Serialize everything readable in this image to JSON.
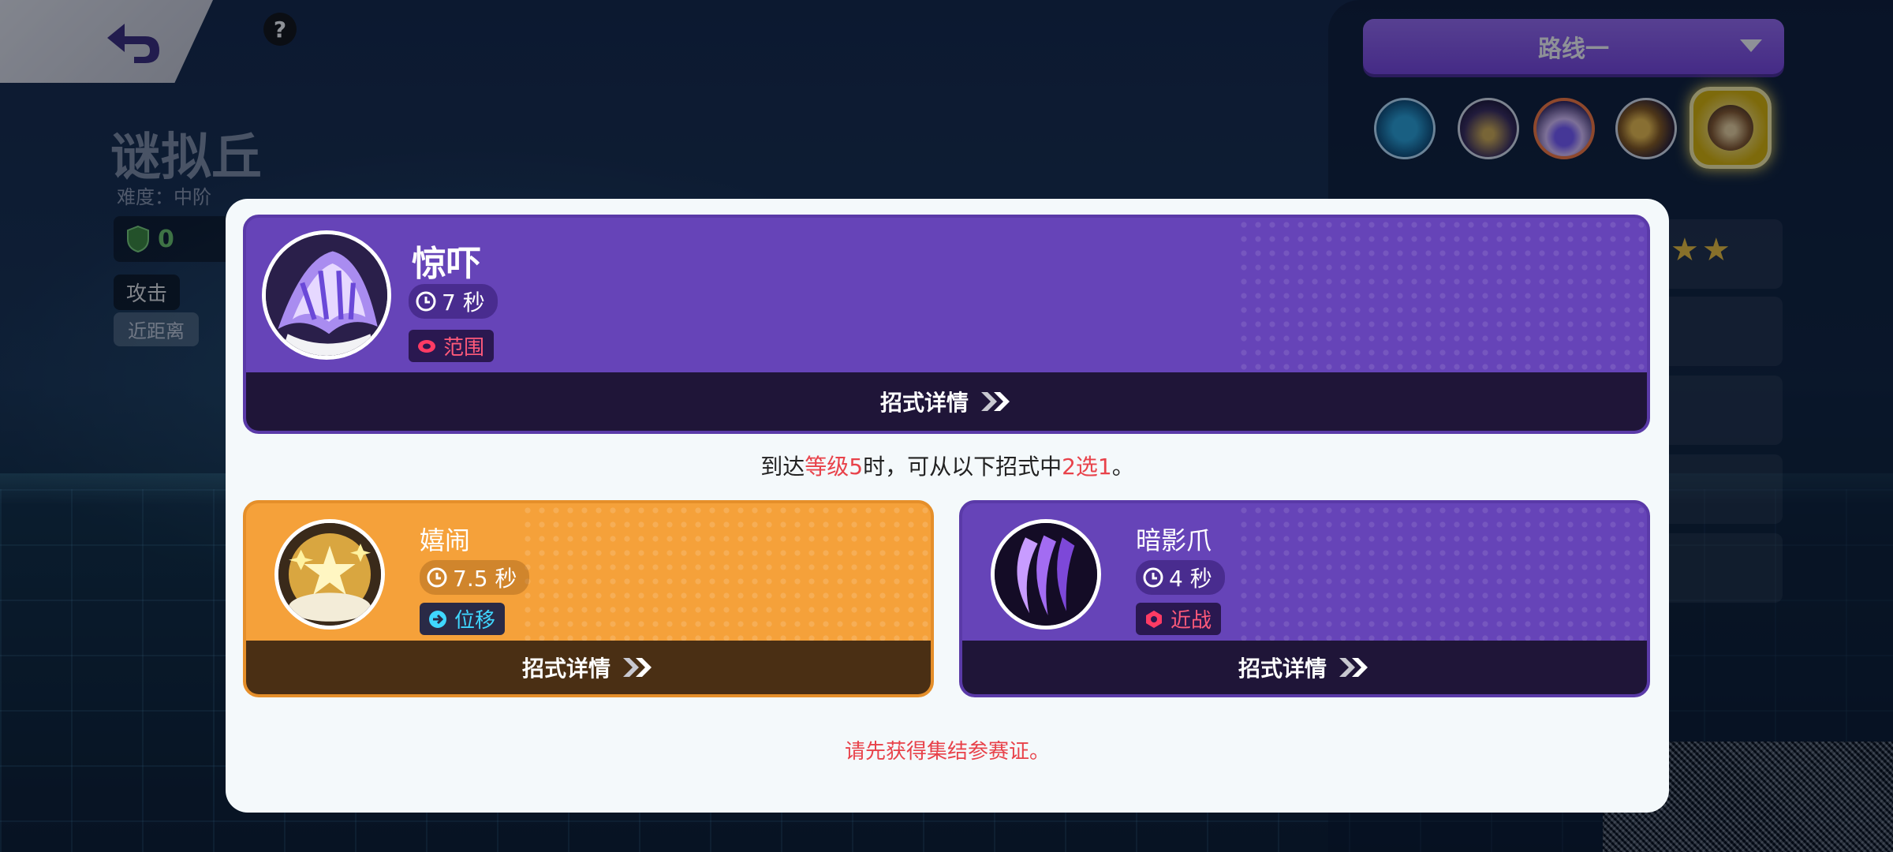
{
  "map": {
    "name": "谜拟丘",
    "difficulty": "难度：中阶",
    "score": "0",
    "role_tag": "攻击",
    "range_tag": "近距离"
  },
  "route": {
    "selected": "路线一"
  },
  "main_move": {
    "name": "惊吓",
    "cooldown": "7 秒",
    "type": "范围",
    "details_label": "招式详情"
  },
  "level_info": {
    "prefix": "到达",
    "level": "等级5",
    "middle": "时，可从以下招式中",
    "choice": "2选1",
    "suffix": "。"
  },
  "option_moves": [
    {
      "name": "嬉闹",
      "cooldown": "7.5 秒",
      "type": "位移",
      "details_label": "招式详情",
      "color": "#f5a13a"
    },
    {
      "name": "暗影爪",
      "cooldown": "4 秒",
      "type": "近战",
      "details_label": "招式详情",
      "color": "#6644b8"
    }
  ],
  "warning": "请先获得集结参赛证。",
  "colors": {
    "accent_purple": "#6644b8",
    "accent_orange": "#f5a13a",
    "highlight_red": "#e8424a",
    "area_tag_color": "#ff5a7a",
    "mobility_tag_color": "#3fd7ff"
  },
  "icons": [
    "back-icon",
    "help-icon",
    "shield-icon",
    "dropdown-caret-icon",
    "clock-icon",
    "area-icon",
    "mobility-icon",
    "melee-icon",
    "double-chevron-icon"
  ]
}
